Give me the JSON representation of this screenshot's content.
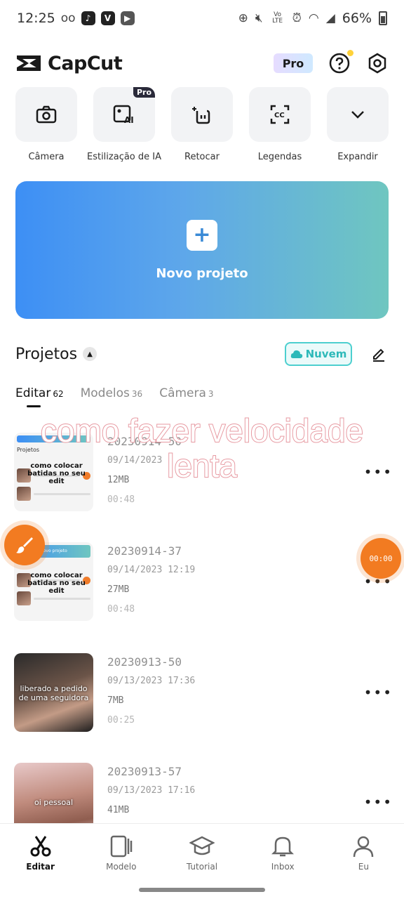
{
  "status_bar": {
    "time": "12:25",
    "carrier_glyph": "oo",
    "app_icons": [
      "tiktok-icon",
      "v-icon",
      "video-icon"
    ],
    "volte_label": "Vo LTE",
    "battery": "66%"
  },
  "header": {
    "app_name": "CapCut",
    "pro_label": "Pro"
  },
  "tools": [
    {
      "label": "Câmera",
      "icon": "camera-icon"
    },
    {
      "label": "Estilização de IA",
      "icon": "ai-style-icon",
      "badge": "Pro"
    },
    {
      "label": "Retocar",
      "icon": "retouch-icon"
    },
    {
      "label": "Legendas",
      "icon": "captions-icon"
    },
    {
      "label": "Expandir",
      "icon": "chevron-down-icon"
    }
  ],
  "new_project": {
    "label": "Novo projeto"
  },
  "projects_section": {
    "title": "Projetos",
    "cloud_label": "Nuvem"
  },
  "tabs": [
    {
      "label": "Editar",
      "count": "62"
    },
    {
      "label": "Modelos",
      "count": "36"
    },
    {
      "label": "Câmera",
      "count": "3"
    }
  ],
  "overlay_title": {
    "line1": "como fazer velocidade",
    "line2": "lenta"
  },
  "projects": [
    {
      "name": "20230914-50",
      "date": "09/14/2023",
      "size": "12MB",
      "duration": "00:48",
      "thumb_caption": "como colocar batidas no seu edit",
      "thumb_header": "Projetos"
    },
    {
      "name": "20230914-37",
      "date": "09/14/2023 12:19",
      "size": "27MB",
      "duration": "00:48",
      "thumb_caption": "como colocar batidas no seu edit",
      "thumb_header": "Novo projeto"
    },
    {
      "name": "20230913-50",
      "date": "09/13/2023 17:36",
      "size": "7MB",
      "duration": "00:25",
      "thumb_caption": "liberado a pedido de uma seguidora"
    },
    {
      "name": "20230913-57",
      "date": "09/13/2023 17:16",
      "size": "41MB",
      "duration": "",
      "thumb_caption": "oi pessoal"
    }
  ],
  "floating": {
    "timer": "00:00"
  },
  "bottom_nav": [
    {
      "label": "Editar",
      "icon": "scissors-icon",
      "active": true
    },
    {
      "label": "Modelo",
      "icon": "template-icon",
      "active": false
    },
    {
      "label": "Tutorial",
      "icon": "graduation-cap-icon",
      "active": false
    },
    {
      "label": "Inbox",
      "icon": "bell-icon",
      "active": false
    },
    {
      "label": "Eu",
      "icon": "person-icon",
      "active": false
    }
  ]
}
